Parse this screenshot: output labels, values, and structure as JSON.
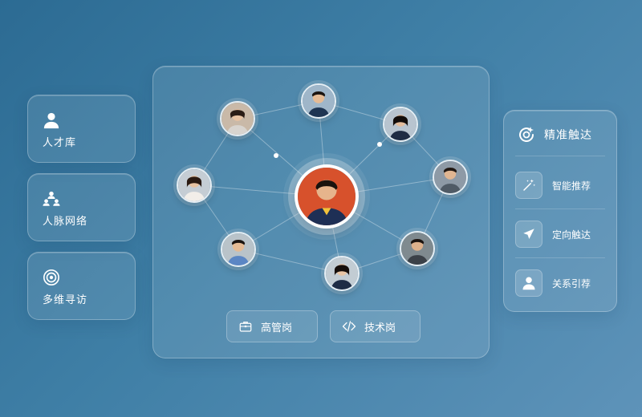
{
  "left_cards": [
    {
      "label": "人才库",
      "icon": "person-icon"
    },
    {
      "label": "人脉网络",
      "icon": "network-icon"
    },
    {
      "label": "多维寻访",
      "icon": "target-icon"
    }
  ],
  "center": {
    "tags": [
      {
        "label": "高管岗",
        "icon": "briefcase-icon"
      },
      {
        "label": "技术岗",
        "icon": "code-icon"
      }
    ]
  },
  "right_panel": {
    "title": "精准触达",
    "title_icon": "target-refresh-icon",
    "items": [
      {
        "label": "智能推荐",
        "icon": "magic-wand-icon"
      },
      {
        "label": "定向触达",
        "icon": "send-icon"
      },
      {
        "label": "关系引荐",
        "icon": "person-icon"
      }
    ]
  },
  "colors": {
    "bg_start": "#2c6b93",
    "bg_end": "#5e93b9",
    "center_avatar_bg": "#d7512c"
  }
}
